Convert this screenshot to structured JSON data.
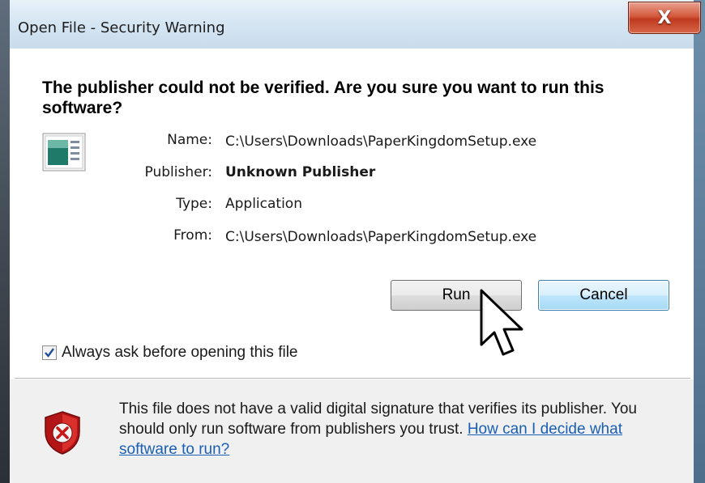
{
  "window": {
    "title": "Open File - Security Warning",
    "close_glyph": "X"
  },
  "headline": "The publisher could not be verified.  Are you sure you want to run this software?",
  "file_icon": "application-file-icon",
  "fields": {
    "name_label": "Name:",
    "name_value": "C:\\Users\\Downloads\\PaperKingdomSetup.exe",
    "publisher_label": "Publisher:",
    "publisher_value": "Unknown Publisher",
    "type_label": "Type:",
    "type_value": "Application",
    "from_label": "From:",
    "from_value": "C:\\Users\\Downloads\\PaperKingdomSetup.exe"
  },
  "buttons": {
    "run": "Run",
    "cancel": "Cancel"
  },
  "checkbox": {
    "label": "Always ask before opening this file",
    "checked": true
  },
  "footer": {
    "icon": "shield-error-icon",
    "text": "This file does not have a valid digital signature that verifies its publisher. You should only run software from publishers you trust.",
    "link": "How can I decide what software to run?"
  },
  "colors": {
    "link": "#1a5fb4",
    "close_button": "#c9472a",
    "shield": "#c8191a"
  }
}
